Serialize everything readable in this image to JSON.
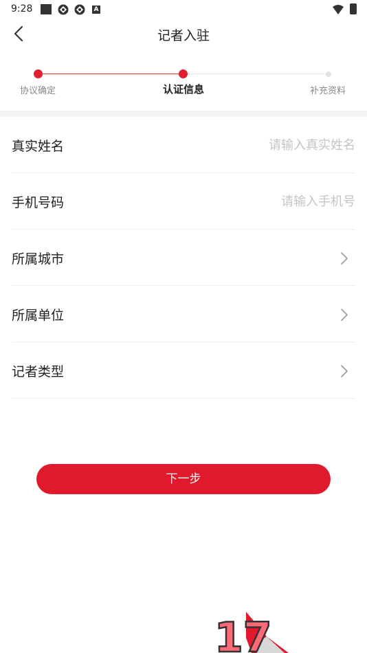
{
  "status_bar": {
    "time": "9:28",
    "a_badge": "A"
  },
  "nav": {
    "title": "记者入驻"
  },
  "steps": [
    {
      "label": "协议确定",
      "state": "done"
    },
    {
      "label": "认证信息",
      "state": "current"
    },
    {
      "label": "补充资料",
      "state": "pending"
    }
  ],
  "form": {
    "real_name": {
      "label": "真实姓名",
      "placeholder": "请输入真实姓名"
    },
    "phone": {
      "label": "手机号码",
      "placeholder": "请输入手机号"
    },
    "city": {
      "label": "所属城市"
    },
    "unit": {
      "label": "所属单位"
    },
    "reporter_type": {
      "label": "记者类型"
    }
  },
  "next_button": {
    "label": "下一步"
  },
  "colors": {
    "accent": "#e0192d",
    "inactive": "#e2e2e2",
    "placeholder": "#c4c4c4"
  },
  "logo_text": "17"
}
